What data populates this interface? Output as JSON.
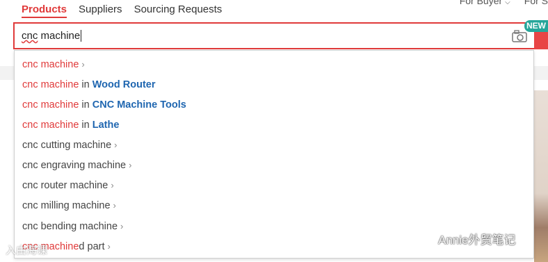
{
  "tabs": [
    {
      "label": "Products"
    },
    {
      "label": "Suppliers"
    },
    {
      "label": "Sourcing Requests"
    }
  ],
  "topnav": {
    "buyer": "For Buyer",
    "seller": "For S"
  },
  "search": {
    "value_part1": "cnc",
    "value_part2": " machine",
    "badge": "NEW"
  },
  "suggestions": [
    {
      "prefix": "cnc machine",
      "mid": "",
      "category": ""
    },
    {
      "prefix": "cnc machine",
      "mid": " in ",
      "category": "Wood Router"
    },
    {
      "prefix": "cnc machine",
      "mid": " in ",
      "category": "CNC Machine Tools"
    },
    {
      "prefix": "cnc machine",
      "mid": " in ",
      "category": "Lathe"
    },
    {
      "text": "cnc cutting machine"
    },
    {
      "text": "cnc engraving machine"
    },
    {
      "text": "cnc router machine"
    },
    {
      "text": "cnc milling machine"
    },
    {
      "text": "cnc bending machine"
    },
    {
      "prefix": "cnc machine",
      "rest": "d part"
    }
  ],
  "watermark": {
    "text": "Annie外贸笔记",
    "text2": "入由海课"
  }
}
